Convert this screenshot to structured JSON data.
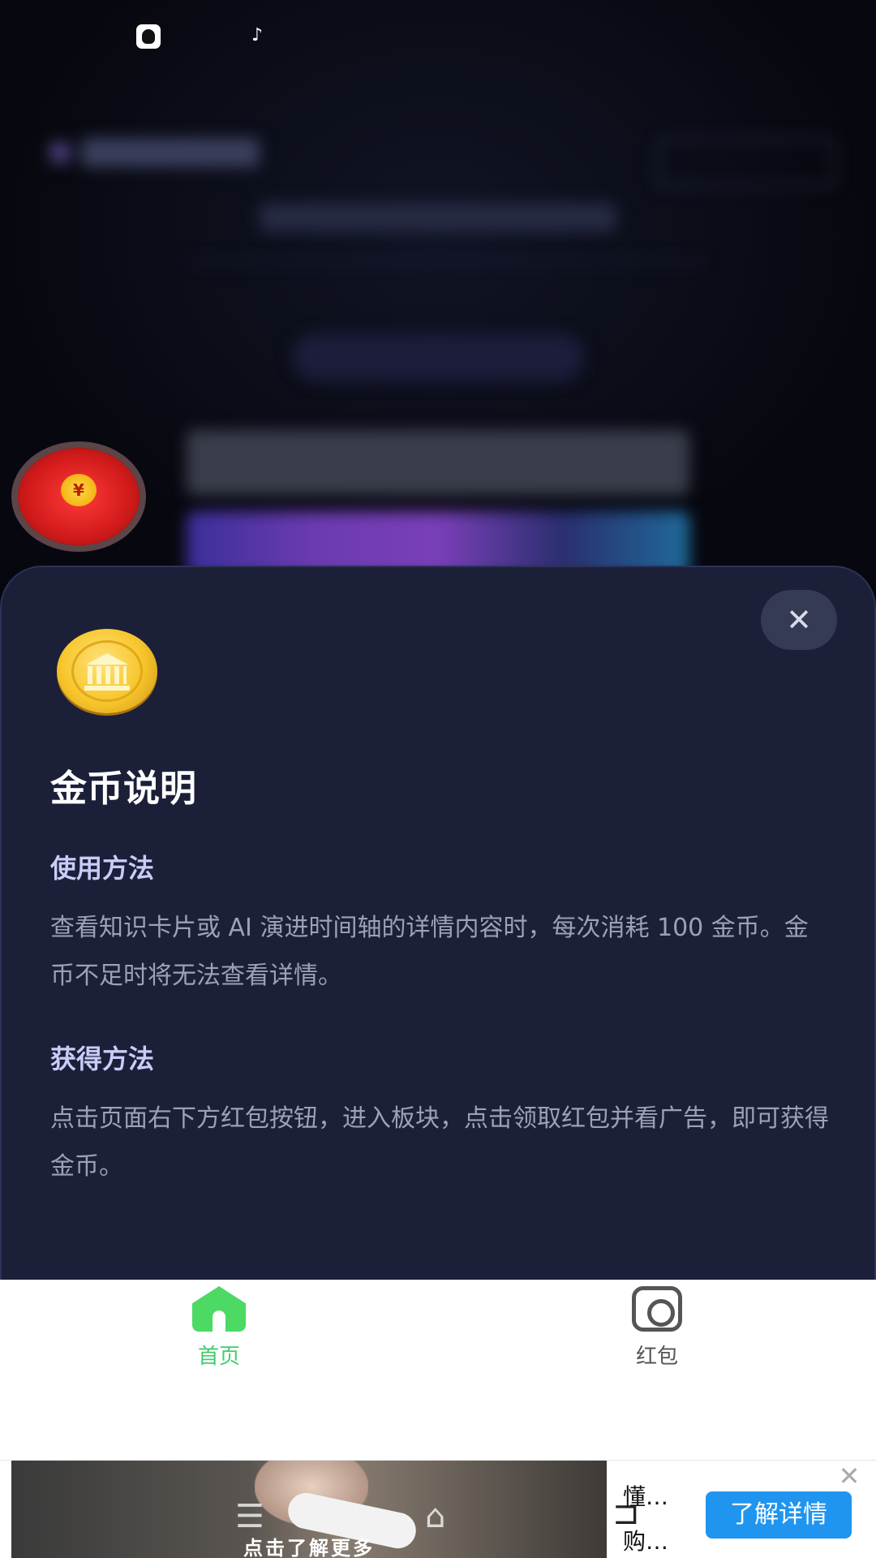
{
  "status_bar": {
    "icons": [
      "qq-icon",
      "tiktok-icon"
    ]
  },
  "red_envelope": {
    "seal_symbol": "¥"
  },
  "coin_info": {
    "title": "金币说明",
    "close_symbol": "✕",
    "sections": [
      {
        "heading": "使用方法",
        "body": "查看知识卡片或 AI 演进时间轴的详情内容时，每次消耗 100 金币。金币不足时将无法查看详情。"
      },
      {
        "heading": "获得方法",
        "body": "点击页面右下方红包按钮，进入板块，点击领取红包并看广告，即可获得金币。"
      }
    ]
  },
  "nav": {
    "items": [
      {
        "label": "首页",
        "icon": "home-icon",
        "active": true,
        "color": "#3fcf6a"
      },
      {
        "label": "红包",
        "icon": "camera-icon",
        "active": false,
        "color": "#555555"
      }
    ]
  },
  "ad": {
    "caption": "点击了解更多",
    "text_line1": "懂…",
    "text_line2": "购…",
    "cta_label": "了解详情",
    "cta_color": "#1f95f0"
  },
  "colors": {
    "sheet_bg": "#1b1f38",
    "heading": "#c8cdf8",
    "body_text": "#9ca1b7"
  }
}
